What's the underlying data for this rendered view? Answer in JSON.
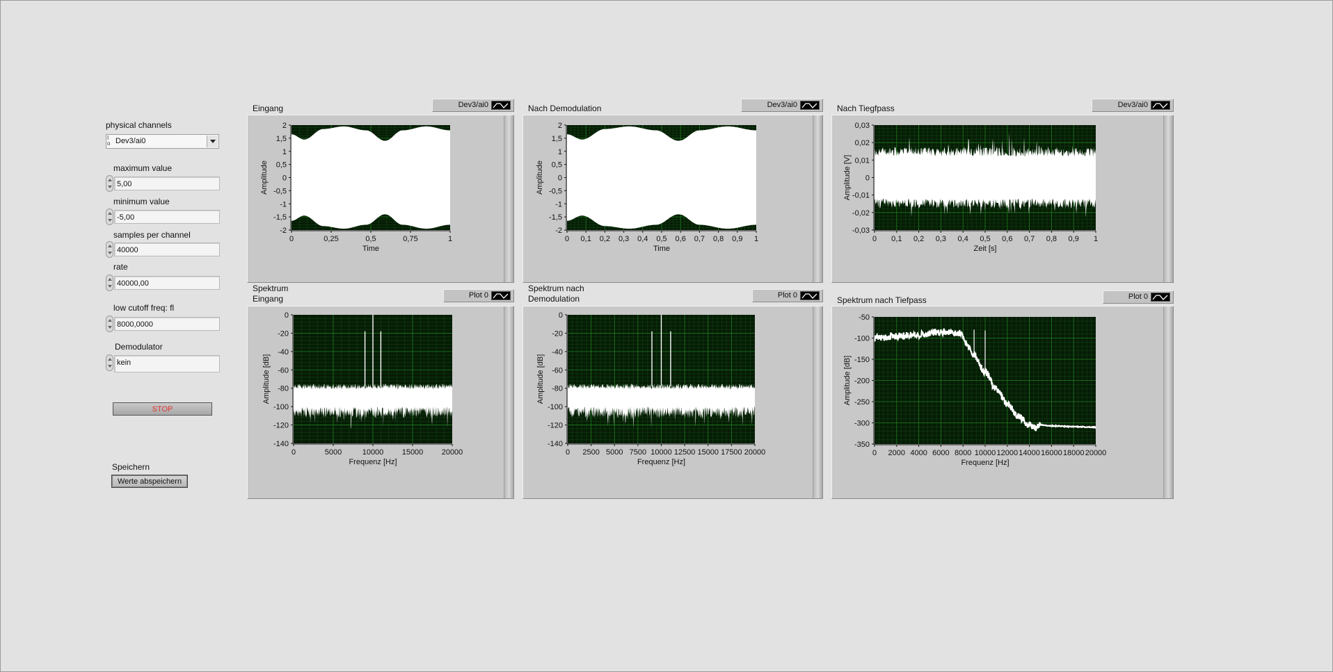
{
  "controls": {
    "physical_channels": {
      "label": "physical channels",
      "value": "Dev3/ai0",
      "io_glyph": "I/O"
    },
    "maximum_value": {
      "label": "maximum value",
      "value": "5,00"
    },
    "minimum_value": {
      "label": "minimum value",
      "value": "-5,00"
    },
    "samples_per_channel": {
      "label": "samples per channel",
      "value": "40000"
    },
    "rate": {
      "label": "rate",
      "value": "40000,00"
    },
    "low_cutoff": {
      "label": "low cutoff freq: fl",
      "value": "8000,0000"
    },
    "demodulator": {
      "label": "Demodulator",
      "value": "kein"
    },
    "stop_label": "STOP",
    "save": {
      "label": "Speichern",
      "button": "Werte abspeichern"
    }
  },
  "colors": {
    "background": "#e2e2e2",
    "plot_background": "#061c06",
    "grid_major": "#1f7a1f",
    "grid_minor": "#0f3d0f",
    "trace": "#ffffff",
    "stop_text": "#e3342f"
  },
  "chart_data": [
    {
      "id": "eingang",
      "type": "area",
      "title": "Eingang",
      "legend": "Dev3/ai0",
      "xlabel": "Time",
      "ylabel": "Amplitude",
      "xlim": [
        0,
        1
      ],
      "ylim": [
        -2,
        2
      ],
      "xticks": [
        "0",
        "0,25",
        "0,5",
        "0,75",
        "1"
      ],
      "yticks": [
        "2",
        "1,5",
        "1",
        "0,5",
        "0",
        "-0,5",
        "-1",
        "-1,5",
        "-2"
      ],
      "envelope_x": [
        0,
        0.08,
        0.2,
        0.33,
        0.47,
        0.59,
        0.7,
        0.85,
        1.0
      ],
      "envelope_upper": [
        1.65,
        1.45,
        1.85,
        1.95,
        1.8,
        1.4,
        1.8,
        1.95,
        1.8
      ],
      "envelope_lower": [
        -1.65,
        -1.45,
        -1.85,
        -1.95,
        -1.8,
        -1.4,
        -1.8,
        -1.95,
        -1.8
      ],
      "grid": true
    },
    {
      "id": "demod",
      "type": "area",
      "title": "Nach Demodulation",
      "legend": "Dev3/ai0",
      "xlabel": "Time",
      "ylabel": "Amplitude",
      "xlim": [
        0,
        1
      ],
      "ylim": [
        -2,
        2
      ],
      "xticks": [
        "0",
        "0,1",
        "0,2",
        "0,3",
        "0,4",
        "0,5",
        "0,6",
        "0,7",
        "0,8",
        "0,9",
        "1"
      ],
      "yticks": [
        "2",
        "1,5",
        "1",
        "0,5",
        "0",
        "-0,5",
        "-1",
        "-1,5",
        "-2"
      ],
      "envelope_x": [
        0,
        0.08,
        0.2,
        0.33,
        0.47,
        0.59,
        0.7,
        0.85,
        1.0
      ],
      "envelope_upper": [
        1.65,
        1.45,
        1.85,
        1.95,
        1.8,
        1.4,
        1.8,
        1.95,
        1.8
      ],
      "envelope_lower": [
        -1.65,
        -1.45,
        -1.85,
        -1.95,
        -1.8,
        -1.4,
        -1.8,
        -1.95,
        -1.8
      ],
      "grid": true
    },
    {
      "id": "tiefpass",
      "type": "area",
      "title": "Nach Tiegfpass",
      "legend": "Dev3/ai0",
      "xlabel": "Zeit [s]",
      "ylabel": "Amplitude [V]",
      "xlim": [
        0,
        1
      ],
      "ylim": [
        -0.03,
        0.03
      ],
      "xticks": [
        "0",
        "0,1",
        "0,2",
        "0,3",
        "0,4",
        "0,5",
        "0,6",
        "0,7",
        "0,8",
        "0,9",
        "1"
      ],
      "yticks": [
        "0,03",
        "0,02",
        "0,01",
        "0",
        "-0,01",
        "-0,02",
        "-0,03"
      ],
      "band_upper": 0.012,
      "band_lower": -0.012,
      "noise_amplitude": 0.007,
      "max_spike": 0.026,
      "grid": true
    },
    {
      "id": "spek-eingang",
      "type": "line",
      "title": "Spektrum\nEingang",
      "legend": "Plot 0",
      "xlabel": "Frequenz [Hz]",
      "ylabel": "Amplitude [dB]",
      "xlim": [
        0,
        20000
      ],
      "ylim": [
        -140,
        0
      ],
      "xticks": [
        "0",
        "5000",
        "10000",
        "15000",
        "20000"
      ],
      "yticks": [
        "0",
        "-20",
        "-40",
        "-60",
        "-80",
        "-100",
        "-120",
        "-140"
      ],
      "floor_upper": -78,
      "floor_lower": -100,
      "bumps": [
        {
          "f": 2500,
          "db": -72
        },
        {
          "f": 6200,
          "db": -70
        },
        {
          "f": 10000,
          "db": -70
        },
        {
          "f": 13700,
          "db": -70
        },
        {
          "f": 17500,
          "db": -72
        }
      ],
      "peaks": [
        {
          "f": 9000,
          "db": -18
        },
        {
          "f": 10000,
          "db": 0
        },
        {
          "f": 11000,
          "db": -18
        }
      ],
      "grid": true
    },
    {
      "id": "spek-demod",
      "type": "line",
      "title": "Spektrum nach\nDemodulation",
      "legend": "Plot 0",
      "xlabel": "Frequenz [Hz]",
      "ylabel": "Amplitude [dB]",
      "xlim": [
        0,
        20000
      ],
      "ylim": [
        -140,
        0
      ],
      "xticks": [
        "0",
        "2500",
        "5000",
        "7500",
        "10000",
        "12500",
        "15000",
        "17500",
        "20000"
      ],
      "yticks": [
        "0",
        "-20",
        "-40",
        "-60",
        "-80",
        "-100",
        "-120",
        "-140"
      ],
      "floor_upper": -78,
      "floor_lower": -100,
      "bumps": [
        {
          "f": 2500,
          "db": -72
        },
        {
          "f": 6200,
          "db": -70
        },
        {
          "f": 10000,
          "db": -70
        },
        {
          "f": 13700,
          "db": -70
        },
        {
          "f": 17500,
          "db": -72
        }
      ],
      "peaks": [
        {
          "f": 9000,
          "db": -18
        },
        {
          "f": 10000,
          "db": 0
        },
        {
          "f": 11000,
          "db": -18
        }
      ],
      "grid": true
    },
    {
      "id": "spek-tiefpass",
      "type": "line",
      "title": "Spektrum nach Tiefpass",
      "legend": "Plot 0",
      "xlabel": "Frequenz [Hz]",
      "ylabel": "Amplitude [dB]",
      "xlim": [
        0,
        20000
      ],
      "ylim": [
        -350,
        -50
      ],
      "xticks": [
        "0",
        "2000",
        "4000",
        "6000",
        "8000",
        "10000",
        "12000",
        "14000",
        "16000",
        "18000",
        "20000"
      ],
      "yticks": [
        "-50",
        "-100",
        "-150",
        "-200",
        "-250",
        "-300",
        "-350"
      ],
      "curve_f": [
        0,
        2000,
        4000,
        6000,
        7800,
        8200,
        9000,
        10000,
        11000,
        12000,
        13000,
        14000,
        14500,
        15000,
        16000,
        18000,
        20000
      ],
      "curve_db": [
        -100,
        -95,
        -92,
        -85,
        -88,
        -110,
        -140,
        -180,
        -220,
        -255,
        -285,
        -305,
        -312,
        -305,
        -307,
        -309,
        -310
      ],
      "peaks": [
        {
          "f": 9000,
          "db": -80
        },
        {
          "f": 10000,
          "db": -82
        }
      ],
      "grid": true
    }
  ]
}
